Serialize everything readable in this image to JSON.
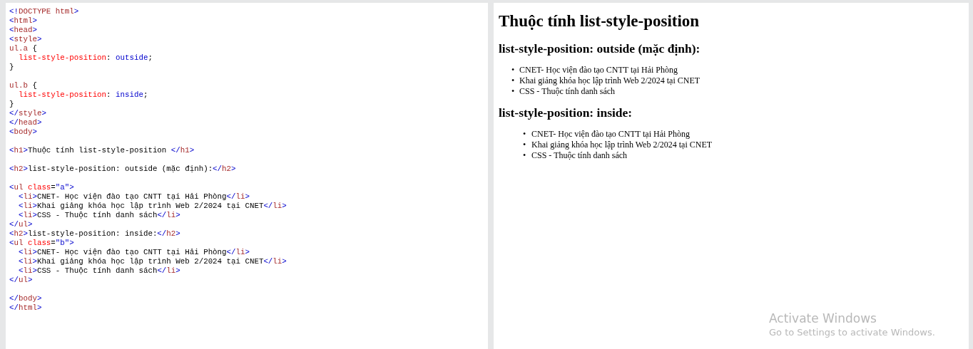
{
  "editor": {
    "lines": [
      {
        "kind": "code",
        "tokens": [
          {
            "kind": "punct",
            "text": "<!"
          },
          {
            "kind": "tag",
            "text": "DOCTYPE html"
          },
          {
            "kind": "punct",
            "text": ">"
          }
        ]
      },
      {
        "kind": "code",
        "tokens": [
          {
            "kind": "punct",
            "text": "<"
          },
          {
            "kind": "tag",
            "text": "html"
          },
          {
            "kind": "punct",
            "text": ">"
          }
        ]
      },
      {
        "kind": "code",
        "tokens": [
          {
            "kind": "punct",
            "text": "<"
          },
          {
            "kind": "tag",
            "text": "head"
          },
          {
            "kind": "punct",
            "text": ">"
          }
        ]
      },
      {
        "kind": "code",
        "tokens": [
          {
            "kind": "punct",
            "text": "<"
          },
          {
            "kind": "tag",
            "text": "style"
          },
          {
            "kind": "punct",
            "text": ">"
          }
        ]
      },
      {
        "kind": "code",
        "tokens": [
          {
            "kind": "tag",
            "text": "ul.a"
          },
          {
            "kind": "text",
            "text": " {"
          }
        ]
      },
      {
        "kind": "code",
        "tokens": [
          {
            "kind": "attr",
            "text": "  list-style-position"
          },
          {
            "kind": "text",
            "text": ": "
          },
          {
            "kind": "value",
            "text": "outside"
          },
          {
            "kind": "text",
            "text": ";"
          }
        ]
      },
      {
        "kind": "code",
        "tokens": [
          {
            "kind": "text",
            "text": "}"
          }
        ]
      },
      {
        "kind": "blank"
      },
      {
        "kind": "code",
        "tokens": [
          {
            "kind": "tag",
            "text": "ul.b"
          },
          {
            "kind": "text",
            "text": " {"
          }
        ]
      },
      {
        "kind": "code",
        "tokens": [
          {
            "kind": "attr",
            "text": "  list-style-position"
          },
          {
            "kind": "text",
            "text": ": "
          },
          {
            "kind": "value",
            "text": "inside"
          },
          {
            "kind": "text",
            "text": ";"
          }
        ]
      },
      {
        "kind": "code",
        "tokens": [
          {
            "kind": "text",
            "text": "}"
          }
        ]
      },
      {
        "kind": "code",
        "tokens": [
          {
            "kind": "punct",
            "text": "</"
          },
          {
            "kind": "tag",
            "text": "style"
          },
          {
            "kind": "punct",
            "text": ">"
          }
        ]
      },
      {
        "kind": "code",
        "tokens": [
          {
            "kind": "punct",
            "text": "</"
          },
          {
            "kind": "tag",
            "text": "head"
          },
          {
            "kind": "punct",
            "text": ">"
          }
        ]
      },
      {
        "kind": "code",
        "tokens": [
          {
            "kind": "punct",
            "text": "<"
          },
          {
            "kind": "tag",
            "text": "body"
          },
          {
            "kind": "punct",
            "text": ">"
          }
        ]
      },
      {
        "kind": "blank"
      },
      {
        "kind": "code",
        "tokens": [
          {
            "kind": "punct",
            "text": "<"
          },
          {
            "kind": "tag",
            "text": "h1"
          },
          {
            "kind": "punct",
            "text": ">"
          },
          {
            "kind": "text",
            "text": "Thuộc tính list-style-position "
          },
          {
            "kind": "punct",
            "text": "</"
          },
          {
            "kind": "tag",
            "text": "h1"
          },
          {
            "kind": "punct",
            "text": ">"
          }
        ]
      },
      {
        "kind": "blank"
      },
      {
        "kind": "code",
        "tokens": [
          {
            "kind": "punct",
            "text": "<"
          },
          {
            "kind": "tag",
            "text": "h2"
          },
          {
            "kind": "punct",
            "text": ">"
          },
          {
            "kind": "text",
            "text": "list-style-position: outside (mặc định):"
          },
          {
            "kind": "punct",
            "text": "</"
          },
          {
            "kind": "tag",
            "text": "h2"
          },
          {
            "kind": "punct",
            "text": ">"
          }
        ]
      },
      {
        "kind": "blank"
      },
      {
        "kind": "code",
        "tokens": [
          {
            "kind": "punct",
            "text": "<"
          },
          {
            "kind": "tag",
            "text": "ul "
          },
          {
            "kind": "attr",
            "text": "class"
          },
          {
            "kind": "text",
            "text": "="
          },
          {
            "kind": "value",
            "text": "\"a\""
          },
          {
            "kind": "punct",
            "text": ">"
          }
        ]
      },
      {
        "kind": "code",
        "tokens": [
          {
            "kind": "punct",
            "text": "  <"
          },
          {
            "kind": "tag",
            "text": "li"
          },
          {
            "kind": "punct",
            "text": ">"
          },
          {
            "kind": "text",
            "text": "CNET- Học viện đào tạo CNTT tại Hải Phòng"
          },
          {
            "kind": "punct",
            "text": "</"
          },
          {
            "kind": "tag",
            "text": "li"
          },
          {
            "kind": "punct",
            "text": ">"
          }
        ]
      },
      {
        "kind": "code",
        "tokens": [
          {
            "kind": "punct",
            "text": "  <"
          },
          {
            "kind": "tag",
            "text": "li"
          },
          {
            "kind": "punct",
            "text": ">"
          },
          {
            "kind": "text",
            "text": "Khai giảng khóa học lập trình Web 2/2024 tại CNET"
          },
          {
            "kind": "punct",
            "text": "</"
          },
          {
            "kind": "tag",
            "text": "li"
          },
          {
            "kind": "punct",
            "text": ">"
          }
        ]
      },
      {
        "kind": "code",
        "tokens": [
          {
            "kind": "punct",
            "text": "  <"
          },
          {
            "kind": "tag",
            "text": "li"
          },
          {
            "kind": "punct",
            "text": ">"
          },
          {
            "kind": "text",
            "text": "CSS - Thuộc tính danh sách"
          },
          {
            "kind": "punct",
            "text": "</"
          },
          {
            "kind": "tag",
            "text": "li"
          },
          {
            "kind": "punct",
            "text": ">"
          }
        ]
      },
      {
        "kind": "code",
        "tokens": [
          {
            "kind": "punct",
            "text": "</"
          },
          {
            "kind": "tag",
            "text": "ul"
          },
          {
            "kind": "punct",
            "text": ">"
          }
        ]
      },
      {
        "kind": "code",
        "tokens": [
          {
            "kind": "punct",
            "text": "<"
          },
          {
            "kind": "tag",
            "text": "h2"
          },
          {
            "kind": "punct",
            "text": ">"
          },
          {
            "kind": "text",
            "text": "list-style-position: inside:"
          },
          {
            "kind": "punct",
            "text": "</"
          },
          {
            "kind": "tag",
            "text": "h2"
          },
          {
            "kind": "punct",
            "text": ">"
          }
        ]
      },
      {
        "kind": "code",
        "tokens": [
          {
            "kind": "punct",
            "text": "<"
          },
          {
            "kind": "tag",
            "text": "ul "
          },
          {
            "kind": "attr",
            "text": "class"
          },
          {
            "kind": "text",
            "text": "="
          },
          {
            "kind": "value",
            "text": "\"b\""
          },
          {
            "kind": "punct",
            "text": ">"
          }
        ]
      },
      {
        "kind": "code",
        "tokens": [
          {
            "kind": "punct",
            "text": "  <"
          },
          {
            "kind": "tag",
            "text": "li"
          },
          {
            "kind": "punct",
            "text": ">"
          },
          {
            "kind": "text",
            "text": "CNET- Học viện đào tạo CNTT tại Hải Phòng"
          },
          {
            "kind": "punct",
            "text": "</"
          },
          {
            "kind": "tag",
            "text": "li"
          },
          {
            "kind": "punct",
            "text": ">"
          }
        ]
      },
      {
        "kind": "code",
        "tokens": [
          {
            "kind": "punct",
            "text": "  <"
          },
          {
            "kind": "tag",
            "text": "li"
          },
          {
            "kind": "punct",
            "text": ">"
          },
          {
            "kind": "text",
            "text": "Khai giảng khóa học lập trình Web 2/2024 tại CNET"
          },
          {
            "kind": "punct",
            "text": "</"
          },
          {
            "kind": "tag",
            "text": "li"
          },
          {
            "kind": "punct",
            "text": ">"
          }
        ]
      },
      {
        "kind": "code",
        "tokens": [
          {
            "kind": "punct",
            "text": "  <"
          },
          {
            "kind": "tag",
            "text": "li"
          },
          {
            "kind": "punct",
            "text": ">"
          },
          {
            "kind": "text",
            "text": "CSS - Thuộc tính danh sách"
          },
          {
            "kind": "punct",
            "text": "</"
          },
          {
            "kind": "tag",
            "text": "li"
          },
          {
            "kind": "punct",
            "text": ">"
          }
        ]
      },
      {
        "kind": "code",
        "tokens": [
          {
            "kind": "punct",
            "text": "</"
          },
          {
            "kind": "tag",
            "text": "ul"
          },
          {
            "kind": "punct",
            "text": ">"
          }
        ]
      },
      {
        "kind": "blank"
      },
      {
        "kind": "code",
        "tokens": [
          {
            "kind": "punct",
            "text": "</"
          },
          {
            "kind": "tag",
            "text": "body"
          },
          {
            "kind": "punct",
            "text": ">"
          }
        ]
      },
      {
        "kind": "code",
        "tokens": [
          {
            "kind": "punct",
            "text": "</"
          },
          {
            "kind": "tag",
            "text": "html"
          },
          {
            "kind": "punct",
            "text": ">"
          }
        ]
      }
    ]
  },
  "preview": {
    "title": "Thuộc tính list-style-position",
    "sections": [
      {
        "heading": "list-style-position: outside (mặc định):",
        "kind": "outside",
        "marker": "•",
        "items": [
          "CNET- Học viện đào tạo CNTT tại Hải Phòng",
          "Khai giảng khóa học lập trình Web 2/2024 tại CNET",
          "CSS - Thuộc tính danh sách"
        ]
      },
      {
        "heading": "list-style-position: inside:",
        "kind": "inside",
        "marker": "•",
        "items": [
          "CNET- Học viện đào tạo CNTT tại Hải Phòng",
          "Khai giảng khóa học lập trình Web 2/2024 tại CNET",
          "CSS - Thuộc tính danh sách"
        ]
      }
    ]
  },
  "activation_notice": {
    "title": "Activate Windows",
    "subtitle": "Go to Settings to activate Windows."
  }
}
